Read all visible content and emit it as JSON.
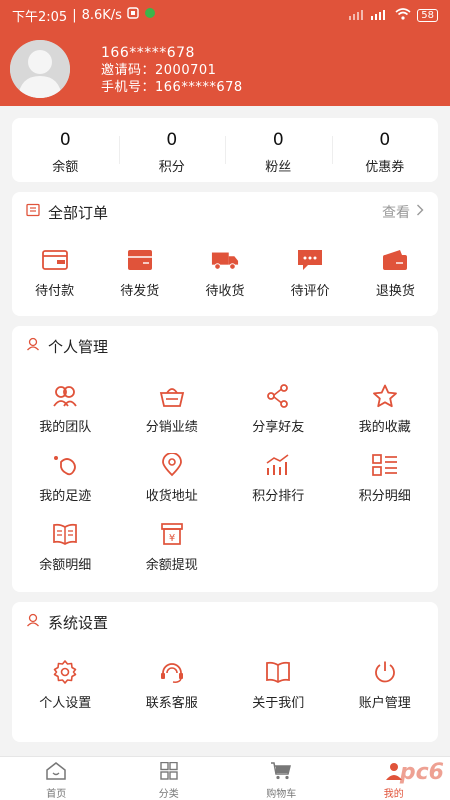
{
  "status_bar": {
    "time": "下午2:05",
    "speed": "8.6K/s",
    "battery": "58"
  },
  "profile": {
    "name": "166*****678",
    "invite": "邀请码：2000701",
    "phone": "手机号：166*****678"
  },
  "stats": [
    {
      "value": "0",
      "label": "余额"
    },
    {
      "value": "0",
      "label": "积分"
    },
    {
      "value": "0",
      "label": "粉丝"
    },
    {
      "value": "0",
      "label": "优惠券"
    }
  ],
  "orders": {
    "title": "全部订单",
    "more": "查看",
    "items": [
      {
        "label": "待付款",
        "icon": "wallet-icon"
      },
      {
        "label": "待发货",
        "icon": "package-icon"
      },
      {
        "label": "待收货",
        "icon": "truck-icon"
      },
      {
        "label": "待评价",
        "icon": "comment-icon"
      },
      {
        "label": "退换货",
        "icon": "return-icon"
      }
    ]
  },
  "personal": {
    "title": "个人管理",
    "items": [
      {
        "label": "我的团队",
        "icon": "team-icon"
      },
      {
        "label": "分销业绩",
        "icon": "basket-icon"
      },
      {
        "label": "分享好友",
        "icon": "share-icon"
      },
      {
        "label": "我的收藏",
        "icon": "star-icon"
      },
      {
        "label": "我的足迹",
        "icon": "footprint-icon"
      },
      {
        "label": "收货地址",
        "icon": "location-icon"
      },
      {
        "label": "积分排行",
        "icon": "ranking-chart-icon"
      },
      {
        "label": "积分明细",
        "icon": "list-detail-icon"
      },
      {
        "label": "余额明细",
        "icon": "book-icon"
      },
      {
        "label": "余额提现",
        "icon": "withdraw-icon"
      }
    ]
  },
  "system": {
    "title": "系统设置",
    "items": [
      {
        "label": "个人设置",
        "icon": "gear-icon"
      },
      {
        "label": "联系客服",
        "icon": "customer-service-icon"
      },
      {
        "label": "关于我们",
        "icon": "open-book-icon"
      },
      {
        "label": "账户管理",
        "icon": "power-icon"
      }
    ]
  },
  "tabbar": [
    {
      "label": "首页",
      "icon": "home-icon"
    },
    {
      "label": "分类",
      "icon": "category-icon"
    },
    {
      "label": "购物车",
      "icon": "cart-icon"
    },
    {
      "label": "我的",
      "icon": "user-icon"
    }
  ],
  "watermark": "pc6",
  "colors": {
    "accent": "#e0533a",
    "background": "#f3f3f3"
  }
}
